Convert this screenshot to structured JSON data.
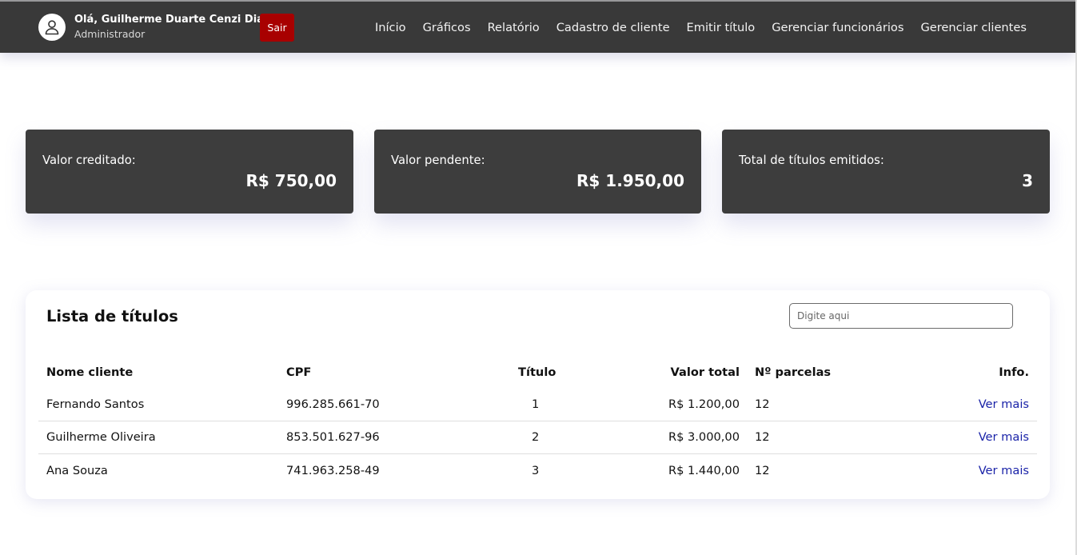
{
  "header": {
    "greeting": "Olá, Guilherme Duarte Cenzi Dias",
    "role": "Administrador",
    "logout_label": "Sair",
    "nav": [
      "Início",
      "Gráficos",
      "Relatório",
      "Cadastro de cliente",
      "Emitir título",
      "Gerenciar funcionários",
      "Gerenciar clientes"
    ]
  },
  "summary": {
    "credited_label": "Valor creditado:",
    "credited_value": "R$ 750,00",
    "pending_label": "Valor pendente:",
    "pending_value": "R$ 1.950,00",
    "issued_label": "Total de títulos emitidos:",
    "issued_value": "3"
  },
  "titles": {
    "heading": "Lista de títulos",
    "search_placeholder": "Digite aqui",
    "columns": [
      "Nome cliente",
      "CPF",
      "Título",
      "Valor total",
      "Nº parcelas",
      "Info."
    ],
    "rows": [
      {
        "name": "Fernando Santos",
        "cpf": "996.285.661-70",
        "title": "1",
        "total": "R$ 1.200,00",
        "installments": "12",
        "info": "Ver mais"
      },
      {
        "name": "Guilherme Oliveira",
        "cpf": "853.501.627-96",
        "title": "2",
        "total": "R$ 3.000,00",
        "installments": "12",
        "info": "Ver mais"
      },
      {
        "name": "Ana Souza",
        "cpf": "741.963.258-49",
        "title": "3",
        "total": "R$ 1.440,00",
        "installments": "12",
        "info": "Ver mais"
      }
    ]
  },
  "colors": {
    "navbar": "#393939",
    "card": "#3d3d3d",
    "logout": "#a80000",
    "link": "#1a23a8"
  }
}
